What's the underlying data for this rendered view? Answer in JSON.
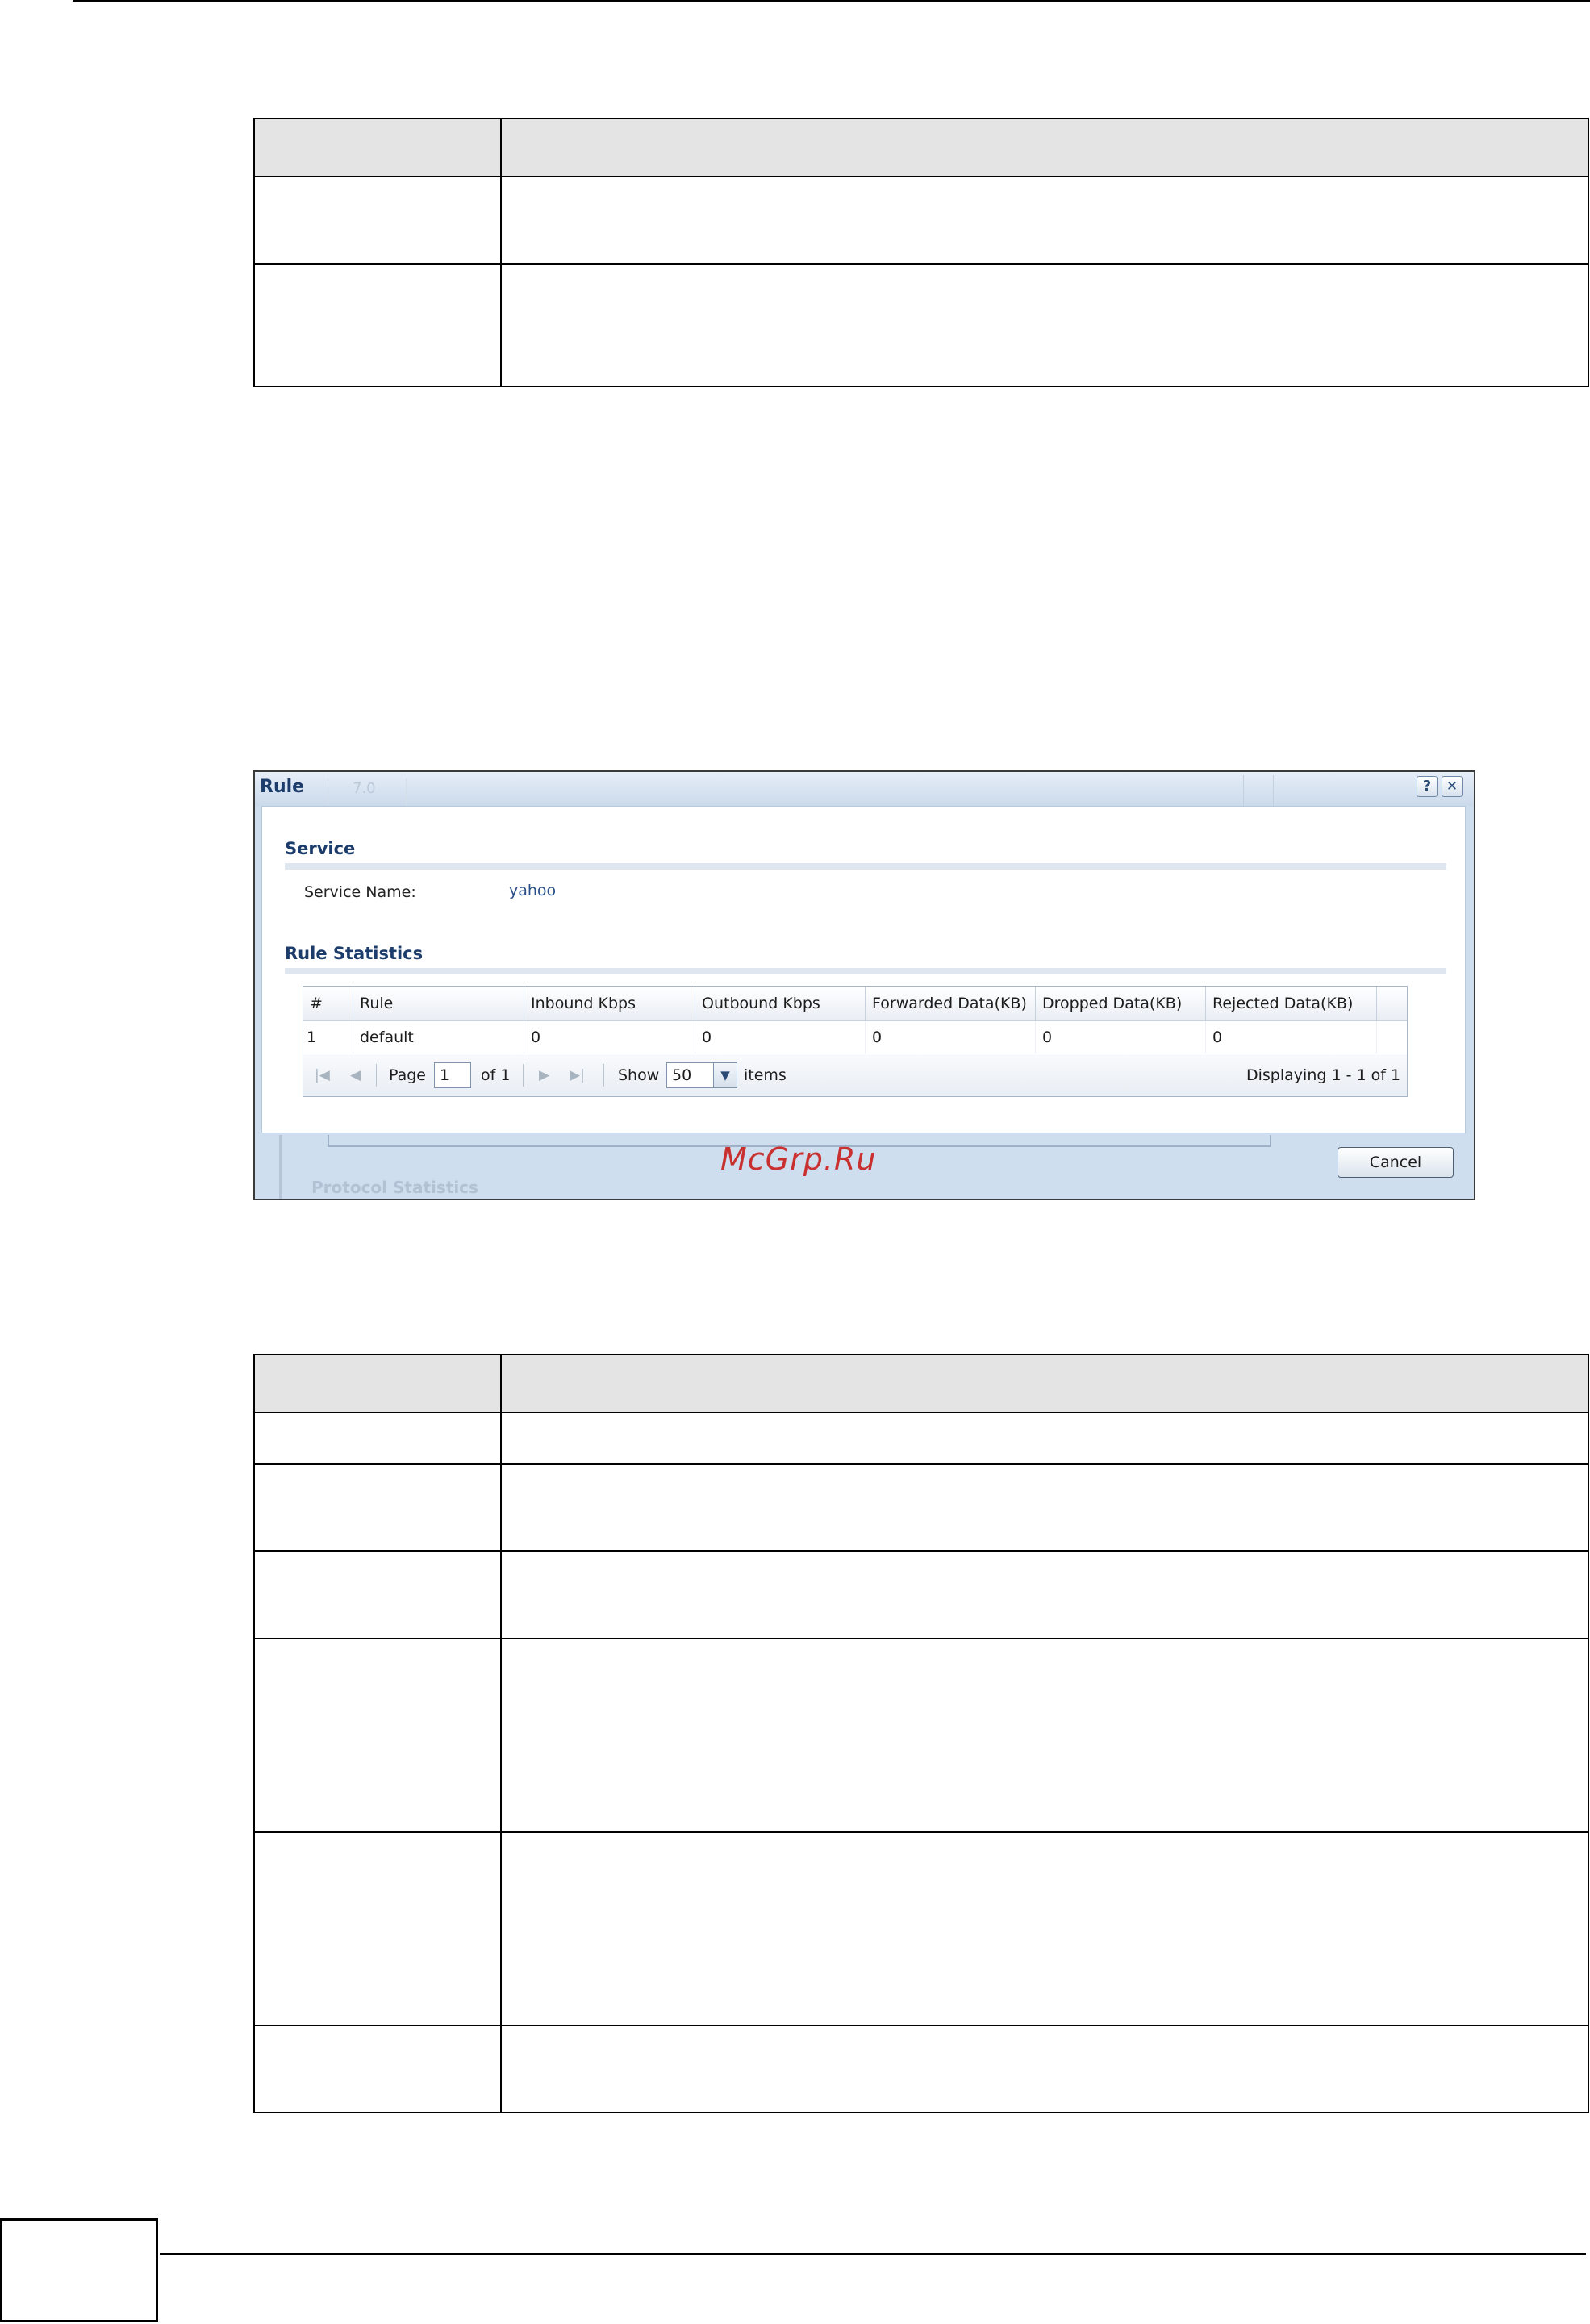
{
  "dialog": {
    "title": "Rule",
    "ghost_tab": "7.0",
    "help_glyph": "?",
    "close_glyph": "✕",
    "service_section": "Service",
    "service_name_label": "Service Name:",
    "service_name_value": "yahoo",
    "stats_section": "Rule Statistics",
    "grid": {
      "columns": [
        "#",
        "Rule",
        "Inbound Kbps",
        "Outbound Kbps",
        "Forwarded Data(KB)",
        "Dropped Data(KB)",
        "Rejected Data(KB)"
      ],
      "rows": [
        [
          "1",
          "default",
          "0",
          "0",
          "0",
          "0",
          "0"
        ]
      ]
    },
    "pager": {
      "page_label": "Page",
      "page_value": "1",
      "of_label": "of 1",
      "show_label": "Show",
      "show_value": "50",
      "items_label": "items",
      "displaying": "Displaying 1 - 1 of 1"
    },
    "ghost_background_text": "Protocol Statistics",
    "cancel_label": "Cancel"
  },
  "watermark": "McGrp.Ru",
  "icons": {
    "first_page": "first-page-icon",
    "prev_page": "prev-page-icon",
    "next_page": "next-page-icon",
    "last_page": "last-page-icon",
    "dropdown": "chevron-down-icon",
    "help": "help-icon",
    "close": "close-icon"
  }
}
